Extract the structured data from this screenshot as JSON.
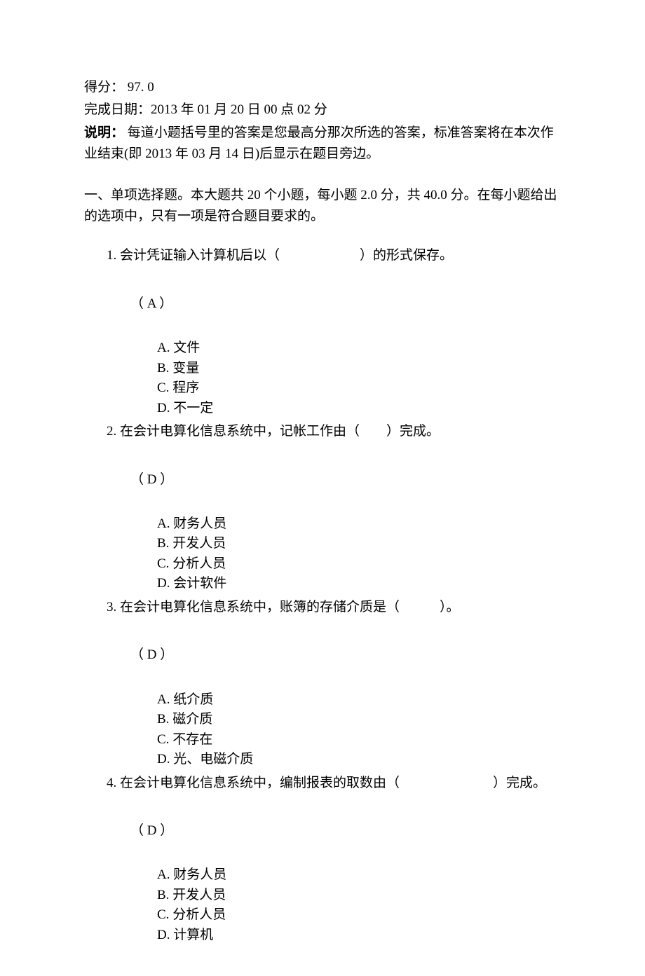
{
  "header": {
    "score_label": "得分：",
    "score_value": " 97. 0",
    "date_label": "完成日期：",
    "date_value": "2013 年 01 月 20 日 00 点 02 分",
    "desc_label": "说明：",
    "desc_text": "  每道小题括号里的答案是您最高分那次所选的答案，标准答案将在本次作业结束(即 2013 年 03 月 14 日)后显示在题目旁边。"
  },
  "section_intro": "一、单项选择题。本大题共 20 个小题，每小题 2.0 分，共 40.0 分。在每小题给出的选项中，只有一项是符合题目要求的。",
  "questions": [
    {
      "num": "1.",
      "stem": "会计凭证输入计算机后以（　　　　　　）的形式保存。",
      "answer": "（ A ）",
      "options": [
        {
          "label": "A.",
          "text": "文件"
        },
        {
          "label": "B.",
          "text": "变量"
        },
        {
          "label": "C.",
          "text": "程序"
        },
        {
          "label": "D.",
          "text": "不一定"
        }
      ]
    },
    {
      "num": "2.",
      "stem": "在会计电算化信息系统中，记帐工作由（　　）完成。",
      "answer": "（ D ）",
      "options": [
        {
          "label": "A.",
          "text": "财务人员"
        },
        {
          "label": "B.",
          "text": "开发人员"
        },
        {
          "label": "C.",
          "text": "分析人员"
        },
        {
          "label": "D.",
          "text": "会计软件"
        }
      ]
    },
    {
      "num": "3.",
      "stem": "在会计电算化信息系统中，账簿的存储介质是（　　　）。",
      "answer": "（ D ）",
      "options": [
        {
          "label": "A.",
          "text": "纸介质"
        },
        {
          "label": "B.",
          "text": "磁介质"
        },
        {
          "label": "C.",
          "text": "不存在"
        },
        {
          "label": "D.",
          "text": "光、电磁介质"
        }
      ]
    },
    {
      "num": "4.",
      "stem": "在会计电算化信息系统中，编制报表的取数由（　　　　　　　）完成。",
      "answer": "（ D ）",
      "options": [
        {
          "label": "A.",
          "text": "财务人员"
        },
        {
          "label": "B.",
          "text": "开发人员"
        },
        {
          "label": "C.",
          "text": "分析人员"
        },
        {
          "label": "D.",
          "text": "计算机"
        }
      ]
    }
  ]
}
